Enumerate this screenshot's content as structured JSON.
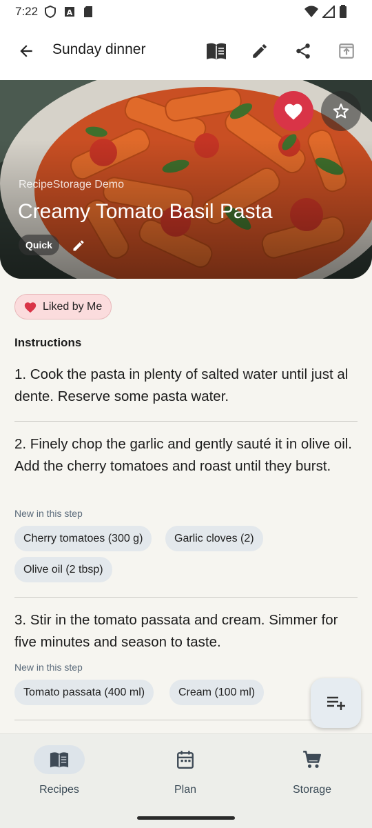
{
  "status_bar": {
    "time": "7:22",
    "left_icons": [
      "shield-icon",
      "font-a-icon",
      "sd-card-icon"
    ],
    "right_icons": [
      "wifi-icon",
      "signal-icon",
      "battery-icon"
    ]
  },
  "app_bar": {
    "title": "Sunday dinner",
    "actions": [
      "book-icon",
      "edit-icon",
      "share-icon",
      "open-in-icon"
    ]
  },
  "hero": {
    "subtitle": "RecipeStorage Demo",
    "title": "Creamy Tomato Basil Pasta",
    "tag": "Quick",
    "favorite": true,
    "colors": {
      "favorite": "#d93447"
    }
  },
  "liked_chip": "Liked by Me",
  "instructions": {
    "heading": "Instructions",
    "new_label": "New in this step",
    "steps": [
      {
        "text": "1. Cook the pasta in plenty of salted water until just al dente. Reserve some pasta water.",
        "ingredients": []
      },
      {
        "text": "2. Finely chop the garlic and gently sauté it in olive oil. Add the cherry tomatoes and roast until they burst.",
        "ingredients": [
          "Cherry tomatoes (300 g)",
          "Garlic cloves (2)",
          "Olive oil (2 tbsp)"
        ]
      },
      {
        "text": "3. Stir in the tomato passata and cream. Simmer for five minutes and season to taste.",
        "ingredients": [
          "Tomato passata (400 ml)",
          "Cream (100 ml)"
        ]
      }
    ]
  },
  "fab": {
    "icon": "playlist-add-icon"
  },
  "bottom_nav": {
    "active": "Recipes",
    "items": [
      {
        "label": "Recipes",
        "icon": "book-icon"
      },
      {
        "label": "Plan",
        "icon": "calendar-icon"
      },
      {
        "label": "Storage",
        "icon": "cart-icon"
      }
    ]
  }
}
